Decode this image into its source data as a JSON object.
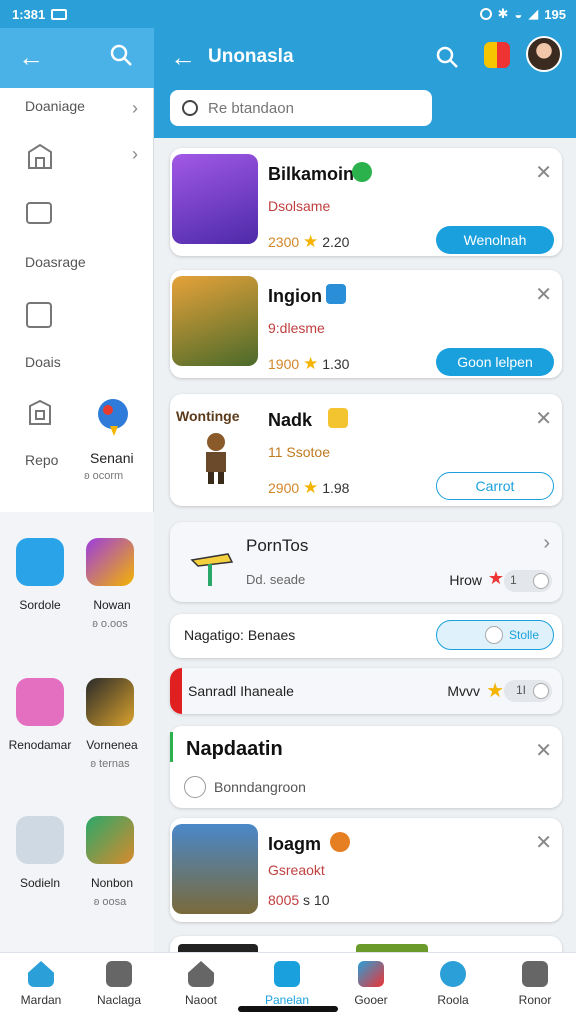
{
  "status_bar": {
    "time": "1:381",
    "right_text": "195"
  },
  "drawer": {
    "items": [
      {
        "label": "Doaniage",
        "has_chevron": true
      },
      {
        "label": "",
        "has_chevron": true
      },
      {
        "label": "Doasrage"
      },
      {
        "label": "Doais"
      },
      {
        "label": "Repo"
      }
    ],
    "featured": {
      "name": "Senani",
      "sub": "ʚ ocorm"
    },
    "apps": [
      {
        "name": "Sordole",
        "sub": ""
      },
      {
        "name": "Nowan",
        "sub": "ʚ o.oos"
      },
      {
        "name": "Renodamar",
        "sub": ""
      },
      {
        "name": "Vornenea",
        "sub": "ʚ ternas"
      },
      {
        "name": "Sodieln",
        "sub": ""
      },
      {
        "name": "Nonbon",
        "sub": "ʚ oosa"
      }
    ]
  },
  "header": {
    "title": "Unonasla",
    "search_placeholder": "Re btandaon"
  },
  "cards": [
    {
      "name": "Bilkamoin",
      "sub": "Dsolsame",
      "count": "2300",
      "rating": "2.20",
      "button": "Wenolnah",
      "button_style": "primary"
    },
    {
      "name": "Ingion",
      "sub": "9:dlesme",
      "count": "1900",
      "rating": "1.30",
      "button": "Goon lelpen",
      "button_style": "primary"
    },
    {
      "name": "Nadk",
      "sub": "11 Ssotoe",
      "count": "2900",
      "rating": "1.98",
      "button": "Carrot",
      "button_style": "outline",
      "thumb_title": "Wontinge"
    },
    {
      "name": "Ioagm",
      "sub": "Gsreaokt",
      "count": "8005",
      "rating": "s 10"
    }
  ],
  "row_portros": {
    "title": "PornTos",
    "sub": "Dd. seade",
    "right_label": "Hrow",
    "toggle_value": "1"
  },
  "row_nagatigo": {
    "label": "Nagatigo: Benaes",
    "toggle_label": "Stolle"
  },
  "row_sanrad": {
    "label": "Sanradl Ihaneale",
    "right_label": "Mvvv",
    "toggle_value": "1I"
  },
  "row_napdaatin": {
    "title": "Napdaatin",
    "sub": "Bonndangroon"
  },
  "bottom_nav": [
    {
      "label": "Mardan",
      "active": false
    },
    {
      "label": "Naclaga",
      "active": false
    },
    {
      "label": "Naoot",
      "active": false
    },
    {
      "label": "Panelan",
      "active": true
    },
    {
      "label": "Gooer",
      "active": false
    },
    {
      "label": "Roola",
      "active": false
    },
    {
      "label": "Ronor",
      "active": false
    }
  ],
  "colors": {
    "accent": "#2a9fd8",
    "button": "#1aa0dd",
    "star": "#f4b400"
  }
}
